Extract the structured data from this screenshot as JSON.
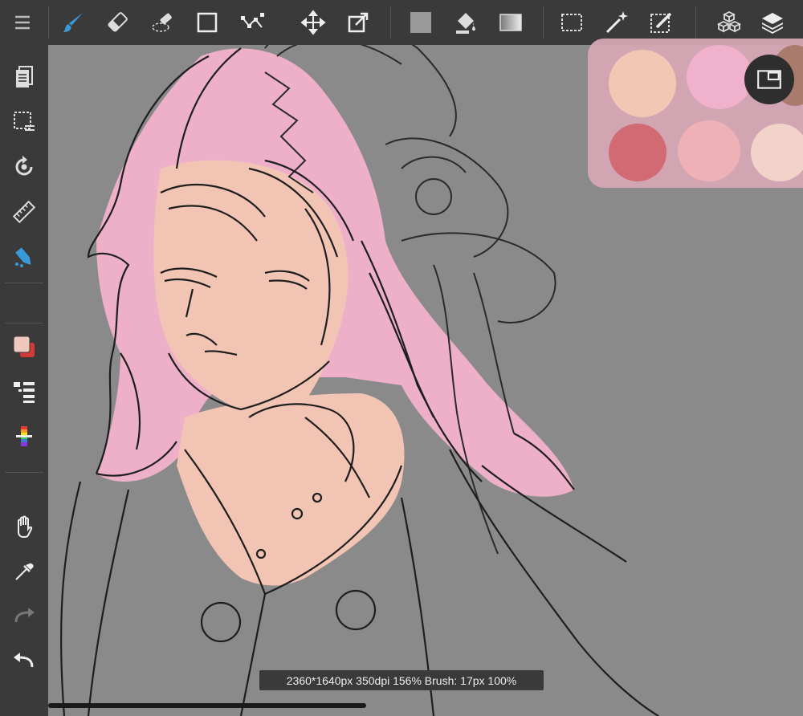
{
  "status": {
    "info": "2360*1640px 350dpi 156% Brush: 17px 100%"
  },
  "colors": {
    "ui_dark": "#3a3a3a",
    "canvas_bg": "#8a8a8a",
    "accent": "#3a9ad9",
    "palette_bg": "#d6a7b4",
    "swatches": [
      "#f2c7b3",
      "#f0b1cc",
      "#a97b6c",
      "#d16a72",
      "#eeb1b6",
      "#f2d3c9"
    ]
  },
  "toolbar": {
    "icons": [
      "menu-icon",
      "brush-icon",
      "eraser-icon",
      "blur-icon",
      "rectangle-icon",
      "polyline-icon",
      "move-icon",
      "transform-icon",
      "fill-color-icon",
      "bucket-icon",
      "gradient-icon",
      "selection-icon",
      "magic-wand-icon",
      "select-pen-icon",
      "materials-icon",
      "layers-icon"
    ]
  },
  "sidebar": {
    "icons": [
      "pages-icon",
      "select-area-icon",
      "rotate-icon",
      "ruler-icon",
      "snap-brush-icon",
      "color-swatch-icon",
      "brush-list-icon",
      "color-palette-icon",
      "hand-icon",
      "eyedropper-icon",
      "redo-icon",
      "undo-icon"
    ]
  }
}
